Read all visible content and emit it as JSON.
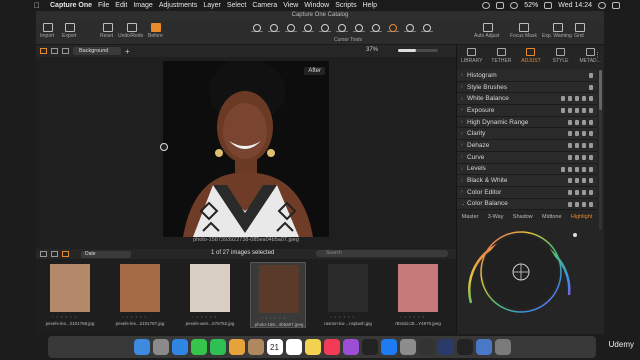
{
  "menubar": {
    "app_name": "Capture One",
    "menus": [
      "File",
      "Edit",
      "Image",
      "Adjustments",
      "Layer",
      "Select",
      "Camera",
      "View",
      "Window",
      "Scripts",
      "Help"
    ],
    "battery": "52%",
    "clock": "Wed 14:24"
  },
  "window": {
    "title": "Capture One Catalog"
  },
  "toolbar": {
    "left": [
      "Import",
      "Export"
    ],
    "middle": [
      "Reset",
      "Undo/Redo",
      "Before"
    ],
    "cursor_tools_label": "Cursor Tools",
    "right": [
      "Auto Adjust",
      "Focus Mask",
      "Exp. Warning",
      "Grid"
    ]
  },
  "viewer": {
    "layer_select": "Background",
    "zoom": "37%",
    "zoom_fraction": 0.45,
    "after_badge": "After",
    "caption": "photo-1587393922738-085ea04b5a07.jpeg"
  },
  "browser": {
    "sort": "Date",
    "count_label": "1 of 27 images selected",
    "search_placeholder": "Search",
    "thumbnails": [
      {
        "filename": "pexels-les...2101768.jpg",
        "color": "#b3896a",
        "selected": false
      },
      {
        "filename": "pexels-les...2101787.jpg",
        "color": "#a56b46",
        "selected": false
      },
      {
        "filename": "pexels-wen...576752.jpg",
        "color": "#d9cfc2",
        "selected": false
      },
      {
        "filename": "photo-158...4b5a07.jpeg",
        "color": "#5a3a2a",
        "selected": true
      },
      {
        "filename": "rasmin-ka-...nsplash.jpg",
        "color": "#2b2b2b",
        "selected": false
      },
      {
        "filename": "rBVal1c3t...Y4970.jpeg",
        "color": "#c77a7a",
        "selected": false
      }
    ]
  },
  "panel": {
    "tabs": [
      {
        "label": "LIBRARY",
        "active": false
      },
      {
        "label": "TETHER",
        "active": false
      },
      {
        "label": "ADJUST",
        "active": true
      },
      {
        "label": "STYLE",
        "active": false
      },
      {
        "label": "METAD...",
        "active": false
      }
    ],
    "tools": [
      "Histogram",
      "Style Brushes",
      "White Balance",
      "Exposure",
      "High Dynamic Range",
      "Clarity",
      "Dehaze",
      "Curve",
      "Levels",
      "Black & White",
      "Color Editor",
      "Color Balance"
    ],
    "color_balance_tabs": [
      {
        "label": "Master",
        "active": false
      },
      {
        "label": "3-Way",
        "active": false
      },
      {
        "label": "Shadow",
        "active": false
      },
      {
        "label": "Midtone",
        "active": false
      },
      {
        "label": "Highlight",
        "active": true
      }
    ]
  },
  "dock": {
    "icons": [
      "finder-icon",
      "launchpad-icon",
      "safari-icon",
      "messages-icon",
      "facetime-icon",
      "photos-icon",
      "contacts-icon",
      "calendar-icon",
      "reminders-icon",
      "notes-icon",
      "music-icon",
      "podcasts-icon",
      "tv-icon",
      "appstore-icon",
      "preferences-icon",
      "capture-one-icon",
      "lightroom-icon",
      "terminal-icon",
      "downloads-icon",
      "trash-icon"
    ],
    "colors": [
      "#3d8ae0",
      "#8a8a8a",
      "#2f86e3",
      "#37c44c",
      "#2fbf53",
      "#e6a33a",
      "#b08860",
      "#ffffff",
      "#ffffff",
      "#f3d250",
      "#f23b57",
      "#9c4fd6",
      "#222222",
      "#1e7cf2",
      "#8d8d8d",
      "#333333",
      "#2a3b6a",
      "#222222",
      "#4a78c8",
      "#7a7a7a"
    ],
    "calendar_day": "21"
  },
  "watermark": "Udemy"
}
